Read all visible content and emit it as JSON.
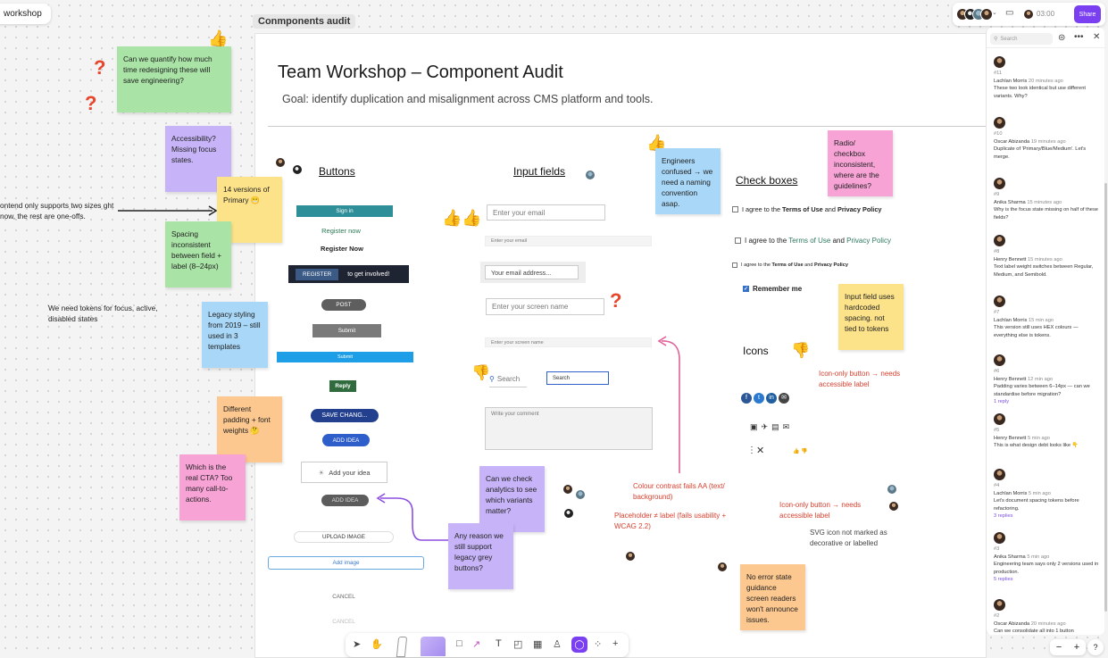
{
  "board_tab": "workshop",
  "frame_label": "Conmponents audit",
  "title": "Team Workshop – Component Audit",
  "goal": "Goal: identify duplication and misalignment across CMS platform and tools.",
  "sections": {
    "buttons": "Buttons",
    "inputs": "Input fields",
    "checkboxes": "Check boxes",
    "icons": "Icons"
  },
  "buttons": {
    "b1": "Sign in",
    "b2": "Register now",
    "b3": "Register Now",
    "b4a": "REGISTER",
    "b4b": "to get involved!",
    "b5": "POST",
    "b6": "Submit",
    "b7": "Submit",
    "b8": "Reply",
    "b9": "SAVE CHANG...",
    "b10": "ADD IDEA",
    "b11": "Add your idea",
    "b12": "ADD IDEA",
    "b13": "UPLOAD IMAGE",
    "b14": "Add image",
    "b15": "CANCEL",
    "b16": "CANCEL"
  },
  "inputs": {
    "i1": "Enter your email",
    "i2": "Enter your email",
    "i3": "Your email address...",
    "i4": "Enter your screen name",
    "i5": "Enter your screen name",
    "i6": "Search",
    "i7": "Search",
    "i8": "Write your comment"
  },
  "checks": {
    "c1a": "I agree to the ",
    "c1b": "Terms of Use",
    "c1c": " and ",
    "c1d": "Privacy Policy",
    "c2a": "I agree to the ",
    "c2b": "Terms of Use",
    "c2c": " and ",
    "c2d": "Privacy Policy",
    "c3a": "I agree to the ",
    "c3b": "Terms of Use",
    "c3c": " and ",
    "c3d": "Privacy Policy",
    "c4": "Remember me"
  },
  "stickies": {
    "s1": "Can we quantify how much time redesigning these will save engineering?",
    "s2": "Accessibility? Missing focus states.",
    "s3": "14 versions of Primary 😬",
    "s4": "Spacing inconsistent between field + label (8–24px)",
    "s5": "Legacy styling from 2019 – still used in 3 templates",
    "s6": "Different padding + font weights 🤔",
    "s7": "Which is the real CTA? Too many call-to-actions.",
    "s8": "Can we check analytics to see which variants matter?",
    "s9": "Any reason we still support legacy grey buttons?",
    "s10": "Engineers confused → we need a naming convention asap.",
    "s11": "Radio/ checkbox inconsistent, where are the guidelines?",
    "s12": "Input field uses hardcoded spacing. not tied to tokens",
    "s13": "No error state guidance screen readers won't announce issues."
  },
  "notes": {
    "n1": "ontend only supports two sizes ght now, the rest are one-offs.",
    "n2": "We need tokens for focus, active, disabled states",
    "n3": "Icon-only button → needs accessible label",
    "n4": "Colour contrast fails AA (text/ background)",
    "n5": "Placeholder ≠ label (fails usability + WCAG 2.2)",
    "n6": "Icon-only button → needs accessible label",
    "n7": "SVG icon not marked as decorative or labelled"
  },
  "panel": {
    "search_placeholder": "Search",
    "comments": [
      {
        "num": "#11",
        "author": "Lachlan Morris",
        "time": "20 minutes ago",
        "text": "These two look identical but use different variants. Why?",
        "replies": ""
      },
      {
        "num": "#10",
        "author": "Oscar Abizanda",
        "time": "19 minutes ago",
        "text": "Duplicate of 'Primary/Blue/Medium'. Let's merge.",
        "replies": ""
      },
      {
        "num": "#9",
        "author": "Anika Sharma",
        "time": "15 minutes ago",
        "text": "Why is the focus state missing on half of these fields?",
        "replies": ""
      },
      {
        "num": "#8",
        "author": "Henry Bennett",
        "time": "15 minutes ago",
        "text": "Text label weight switches between Regular, Medium, and Semibold.",
        "replies": ""
      },
      {
        "num": "#7",
        "author": "Lachlan Morris",
        "time": "15 min ago",
        "text": "This version still uses HEX colours — everything else is tokens.",
        "replies": ""
      },
      {
        "num": "#6",
        "author": "Henry Bennett",
        "time": "12 min ago",
        "text": "Padding varies between 6–14px — can we standardise before migration?",
        "replies": "1 reply"
      },
      {
        "num": "#5",
        "author": "Henry Bennett",
        "time": "5 min ago",
        "text": "This is what design debt looks like 👇",
        "replies": ""
      },
      {
        "num": "#4",
        "author": "Lachlan Morris",
        "time": "5 min ago",
        "text": "Let's document spacing tokens before refactoring.",
        "replies": "3 replies"
      },
      {
        "num": "#3",
        "author": "Anika Sharma",
        "time": "5 min ago",
        "text": "Engineering team says only 2 versions used in production.",
        "replies": "5 replies"
      },
      {
        "num": "#2",
        "author": "Oscar Abizanda",
        "time": "20 minutes ago",
        "text": "Can we consolidate all into 1 button",
        "replies": ""
      }
    ]
  },
  "topbar": {
    "timer": "03:00",
    "share": "Share"
  },
  "zoom": {
    "minus": "−",
    "plus": "+",
    "help": "?"
  }
}
